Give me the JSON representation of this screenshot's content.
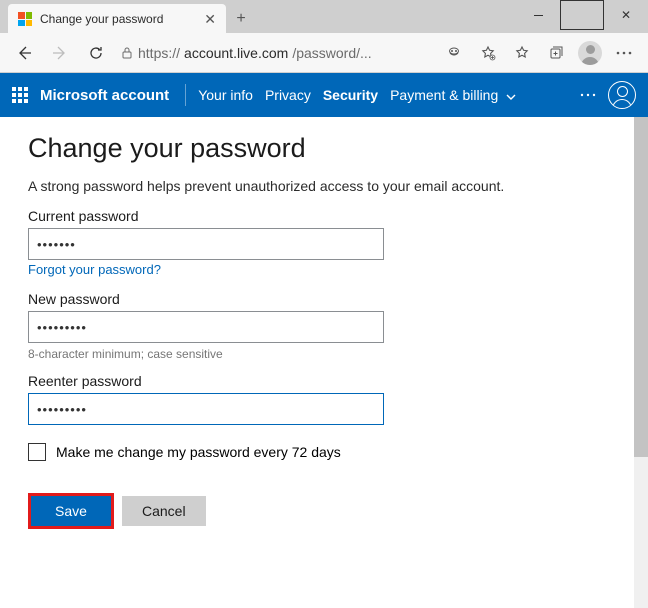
{
  "window": {
    "tab_title": "Change your password",
    "url_display_proto": "https://",
    "url_display_host": "account.live.com",
    "url_display_path": "/password/..."
  },
  "header": {
    "brand": "Microsoft account",
    "nav": {
      "your_info": "Your info",
      "privacy": "Privacy",
      "security": "Security",
      "payment": "Payment & billing"
    }
  },
  "page": {
    "title": "Change your password",
    "subtitle": "A strong password helps prevent unauthorized access to your email account.",
    "current_label": "Current password",
    "current_value": "•••••••",
    "forgot_link": "Forgot your password?",
    "new_label": "New password",
    "new_value": "•••••••••",
    "hint": "8-character minimum; case sensitive",
    "reenter_label": "Reenter password",
    "reenter_value": "•••••••••",
    "checkbox_label": "Make me change my password every 72 days",
    "save_label": "Save",
    "cancel_label": "Cancel"
  }
}
